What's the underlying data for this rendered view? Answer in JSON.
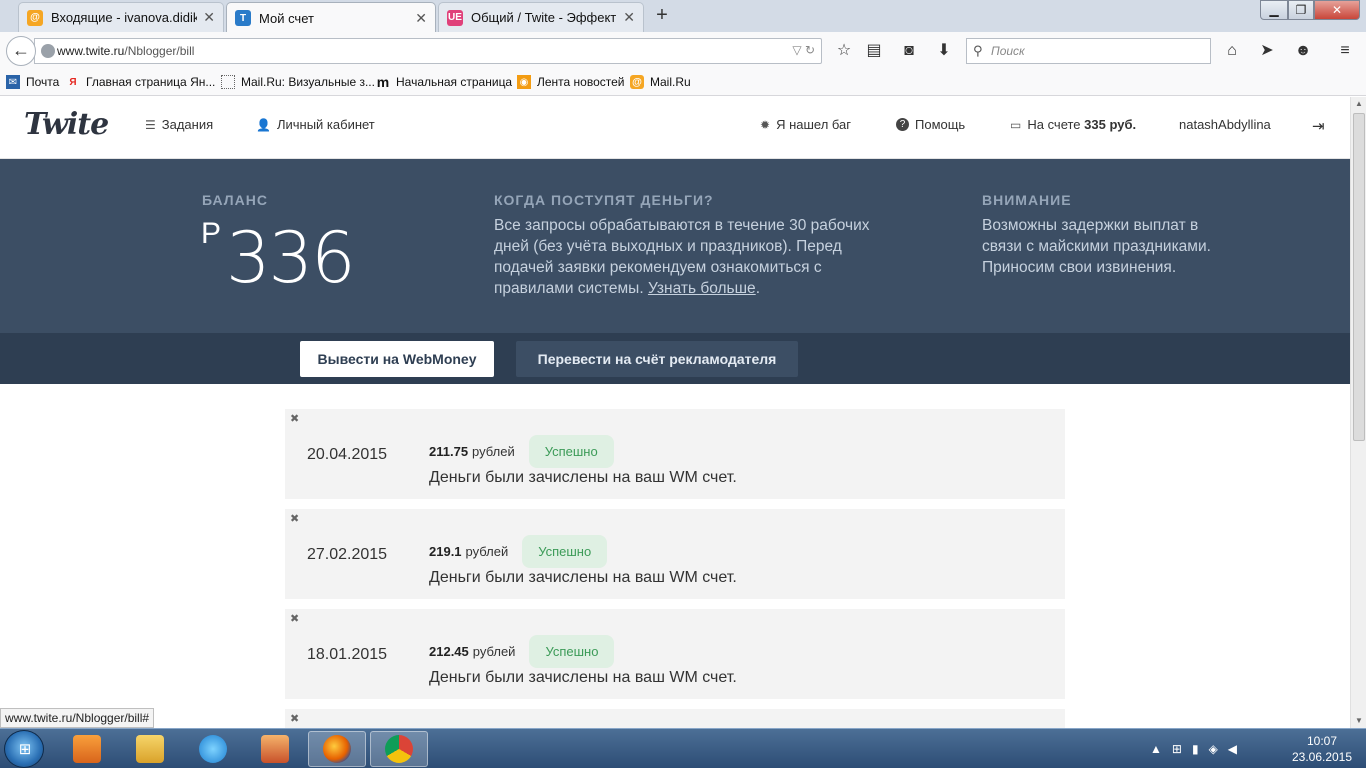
{
  "browser": {
    "tabs": [
      {
        "title": "Входящие - ivanova.didika...",
        "active": false,
        "favicon": "mailru-icon"
      },
      {
        "title": "Мой счет",
        "active": true,
        "favicon": "twite-icon"
      },
      {
        "title": "Общий / Twite - Эффекти...",
        "active": false,
        "favicon": "ue-icon"
      }
    ],
    "new_tab_symbol": "+",
    "url_host": "www.twite.ru",
    "url_path": "/Nblogger/bill",
    "search_placeholder": "Поиск",
    "bookmarks": [
      {
        "label": "Почта",
        "icon": "mail-icon"
      },
      {
        "label": "Главная страница Ян...",
        "icon": "yandex-icon"
      },
      {
        "label": "Mail.Ru: Визуальные з...",
        "icon": "blank-page-icon"
      },
      {
        "label": "Начальная страница",
        "icon": "m-icon"
      },
      {
        "label": "Лента новостей",
        "icon": "rss-icon"
      },
      {
        "label": "Mail.Ru",
        "icon": "mailru-icon"
      }
    ],
    "status_url": "www.twite.ru/Nblogger/bill#"
  },
  "site": {
    "logo": "Twite",
    "nav": {
      "tasks": "Задания",
      "cabinet": "Личный кабинет",
      "bug": "Я нашел баг",
      "help": "Помощь",
      "account_prefix": "На счете",
      "account_amount": "335 руб.",
      "username": "natashAbdyllina"
    }
  },
  "balance": {
    "heading": "БАЛАНС",
    "currency": "Р",
    "value": "336"
  },
  "info": {
    "heading": "КОГДА ПОСТУПЯТ ДЕНЬГИ?",
    "text": "Все запросы обрабатываются в течение 30 рабочих дней (без учёта выходных и праздников). Перед подачей заявки рекомендуем ознакомиться с правилами системы.",
    "link": "Узнать больше",
    "after_link": "."
  },
  "warning": {
    "heading": "ВНИМАНИЕ",
    "text": "Возможны задержки выплат в связи с майскими праздниками. Приносим свои извинения."
  },
  "actions": {
    "withdraw": "Вывести на WebMoney",
    "transfer": "Перевести на счёт рекламодателя"
  },
  "transactions": [
    {
      "date": "20.04.2015",
      "amount": "211.75",
      "unit": "рублей",
      "status": "Успешно",
      "message": "Деньги были зачислены на ваш WM счет."
    },
    {
      "date": "27.02.2015",
      "amount": "219.1",
      "unit": "рублей",
      "status": "Успешно",
      "message": "Деньги были зачислены на ваш WM счет."
    },
    {
      "date": "18.01.2015",
      "amount": "212.45",
      "unit": "рублей",
      "status": "Успешно",
      "message": "Деньги были зачислены на ваш WM счет."
    }
  ],
  "taskbar": {
    "time": "10:07",
    "date": "23.06.2015"
  },
  "colors": {
    "panel": "#3c4e64",
    "action_bar": "#2e3e52",
    "success_bg": "#dff0e3",
    "success_text": "#3c9b58"
  }
}
